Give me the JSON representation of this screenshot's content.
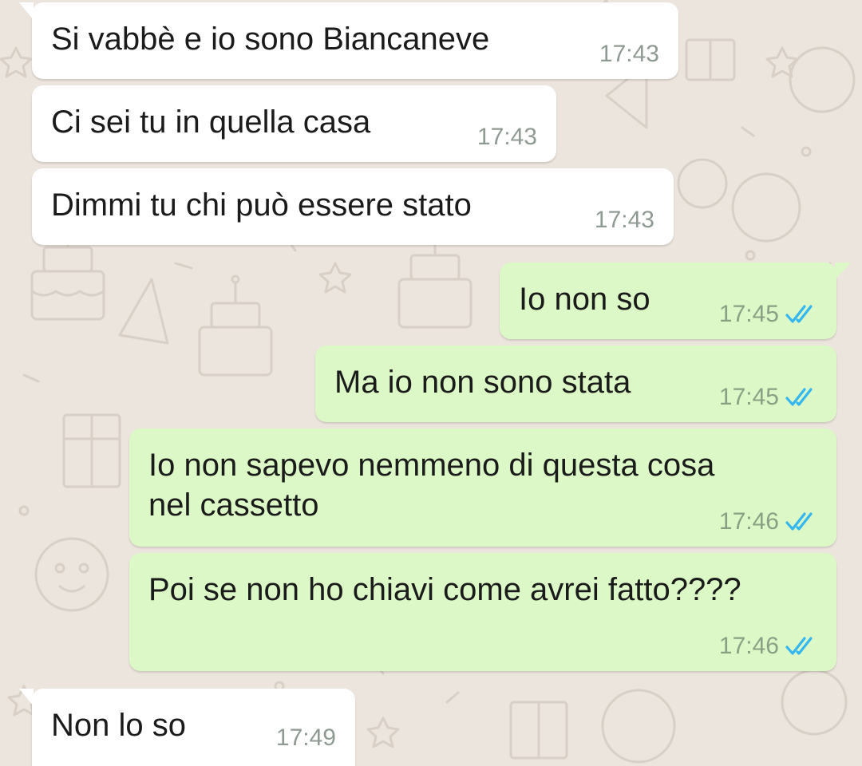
{
  "colors": {
    "chat_background": "#ece5dd",
    "incoming_bubble": "#ffffff",
    "outgoing_bubble": "#dcf8c6",
    "read_ticks": "#34b7f1",
    "timestamp": "#8f9a92"
  },
  "messages": [
    {
      "direction": "incoming",
      "text": "Si vabbè e io sono Biancaneve",
      "time": "17:43"
    },
    {
      "direction": "incoming",
      "text": "Ci sei tu in quella casa",
      "time": "17:43"
    },
    {
      "direction": "incoming",
      "text": "Dimmi tu chi può essere stato",
      "time": "17:43"
    },
    {
      "direction": "outgoing",
      "text": "Io non so",
      "time": "17:45",
      "status": "read",
      "status_icon": "double-check-icon"
    },
    {
      "direction": "outgoing",
      "text": "Ma io non sono stata",
      "time": "17:45",
      "status": "read",
      "status_icon": "double-check-icon"
    },
    {
      "direction": "outgoing",
      "text": "Io non sapevo nemmeno di questa cosa\nnel cassetto",
      "time": "17:46",
      "status": "read",
      "status_icon": "double-check-icon"
    },
    {
      "direction": "outgoing",
      "text": "Poi se non ho chiavi come avrei fatto????",
      "time": "17:46",
      "status": "read",
      "status_icon": "double-check-icon"
    },
    {
      "direction": "incoming",
      "text": "Non lo so",
      "time": "17:49"
    }
  ]
}
